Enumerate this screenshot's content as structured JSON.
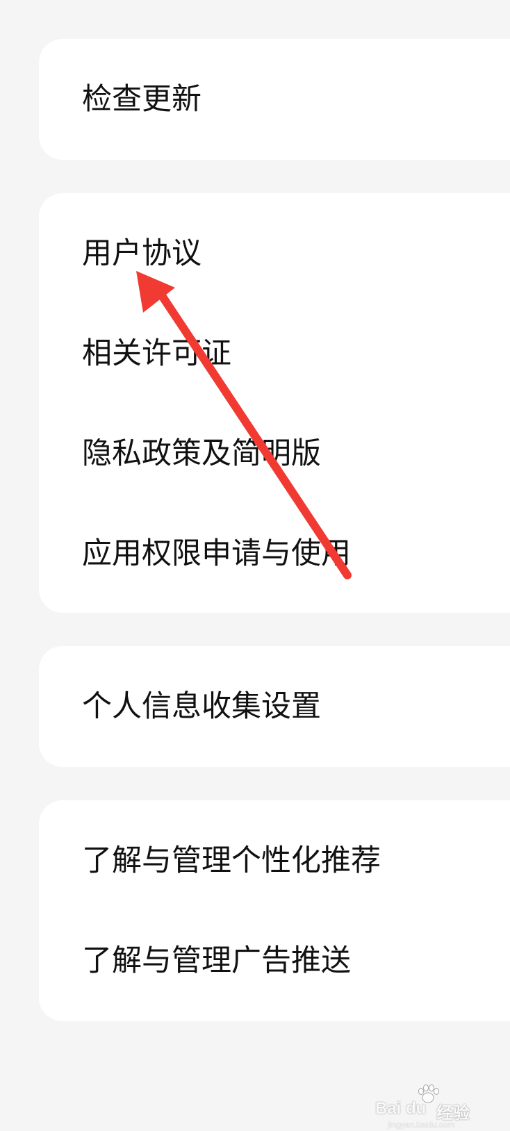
{
  "groups": [
    {
      "items": [
        {
          "label": "检查更新"
        }
      ]
    },
    {
      "items": [
        {
          "label": "用户协议"
        },
        {
          "label": "相关许可证"
        },
        {
          "label": "隐私政策及简明版"
        },
        {
          "label": "应用权限申请与使用"
        }
      ]
    },
    {
      "items": [
        {
          "label": "个人信息收集设置"
        }
      ]
    },
    {
      "items": [
        {
          "label": "了解与管理个性化推荐"
        },
        {
          "label": "了解与管理广告推送"
        }
      ]
    }
  ],
  "annotation": {
    "arrow_color": "#f03a32"
  },
  "watermark": {
    "brand": "Bai du",
    "product": "经验",
    "url": "jingyan.baidu.com"
  }
}
